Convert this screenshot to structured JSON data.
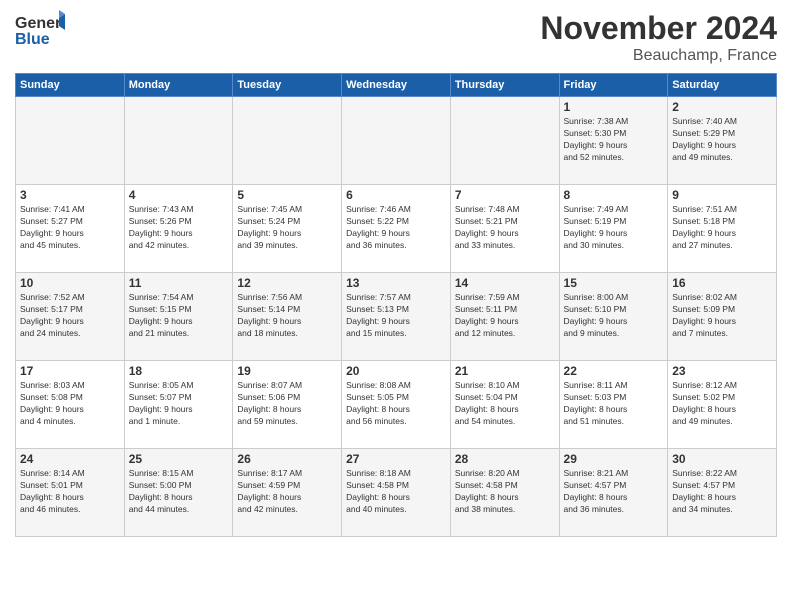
{
  "logo": {
    "general": "General",
    "blue": "Blue"
  },
  "title": {
    "month": "November 2024",
    "location": "Beauchamp, France"
  },
  "weekdays": [
    "Sunday",
    "Monday",
    "Tuesday",
    "Wednesday",
    "Thursday",
    "Friday",
    "Saturday"
  ],
  "weeks": [
    [
      {
        "day": "",
        "info": ""
      },
      {
        "day": "",
        "info": ""
      },
      {
        "day": "",
        "info": ""
      },
      {
        "day": "",
        "info": ""
      },
      {
        "day": "",
        "info": ""
      },
      {
        "day": "1",
        "info": "Sunrise: 7:38 AM\nSunset: 5:30 PM\nDaylight: 9 hours\nand 52 minutes."
      },
      {
        "day": "2",
        "info": "Sunrise: 7:40 AM\nSunset: 5:29 PM\nDaylight: 9 hours\nand 49 minutes."
      }
    ],
    [
      {
        "day": "3",
        "info": "Sunrise: 7:41 AM\nSunset: 5:27 PM\nDaylight: 9 hours\nand 45 minutes."
      },
      {
        "day": "4",
        "info": "Sunrise: 7:43 AM\nSunset: 5:26 PM\nDaylight: 9 hours\nand 42 minutes."
      },
      {
        "day": "5",
        "info": "Sunrise: 7:45 AM\nSunset: 5:24 PM\nDaylight: 9 hours\nand 39 minutes."
      },
      {
        "day": "6",
        "info": "Sunrise: 7:46 AM\nSunset: 5:22 PM\nDaylight: 9 hours\nand 36 minutes."
      },
      {
        "day": "7",
        "info": "Sunrise: 7:48 AM\nSunset: 5:21 PM\nDaylight: 9 hours\nand 33 minutes."
      },
      {
        "day": "8",
        "info": "Sunrise: 7:49 AM\nSunset: 5:19 PM\nDaylight: 9 hours\nand 30 minutes."
      },
      {
        "day": "9",
        "info": "Sunrise: 7:51 AM\nSunset: 5:18 PM\nDaylight: 9 hours\nand 27 minutes."
      }
    ],
    [
      {
        "day": "10",
        "info": "Sunrise: 7:52 AM\nSunset: 5:17 PM\nDaylight: 9 hours\nand 24 minutes."
      },
      {
        "day": "11",
        "info": "Sunrise: 7:54 AM\nSunset: 5:15 PM\nDaylight: 9 hours\nand 21 minutes."
      },
      {
        "day": "12",
        "info": "Sunrise: 7:56 AM\nSunset: 5:14 PM\nDaylight: 9 hours\nand 18 minutes."
      },
      {
        "day": "13",
        "info": "Sunrise: 7:57 AM\nSunset: 5:13 PM\nDaylight: 9 hours\nand 15 minutes."
      },
      {
        "day": "14",
        "info": "Sunrise: 7:59 AM\nSunset: 5:11 PM\nDaylight: 9 hours\nand 12 minutes."
      },
      {
        "day": "15",
        "info": "Sunrise: 8:00 AM\nSunset: 5:10 PM\nDaylight: 9 hours\nand 9 minutes."
      },
      {
        "day": "16",
        "info": "Sunrise: 8:02 AM\nSunset: 5:09 PM\nDaylight: 9 hours\nand 7 minutes."
      }
    ],
    [
      {
        "day": "17",
        "info": "Sunrise: 8:03 AM\nSunset: 5:08 PM\nDaylight: 9 hours\nand 4 minutes."
      },
      {
        "day": "18",
        "info": "Sunrise: 8:05 AM\nSunset: 5:07 PM\nDaylight: 9 hours\nand 1 minute."
      },
      {
        "day": "19",
        "info": "Sunrise: 8:07 AM\nSunset: 5:06 PM\nDaylight: 8 hours\nand 59 minutes."
      },
      {
        "day": "20",
        "info": "Sunrise: 8:08 AM\nSunset: 5:05 PM\nDaylight: 8 hours\nand 56 minutes."
      },
      {
        "day": "21",
        "info": "Sunrise: 8:10 AM\nSunset: 5:04 PM\nDaylight: 8 hours\nand 54 minutes."
      },
      {
        "day": "22",
        "info": "Sunrise: 8:11 AM\nSunset: 5:03 PM\nDaylight: 8 hours\nand 51 minutes."
      },
      {
        "day": "23",
        "info": "Sunrise: 8:12 AM\nSunset: 5:02 PM\nDaylight: 8 hours\nand 49 minutes."
      }
    ],
    [
      {
        "day": "24",
        "info": "Sunrise: 8:14 AM\nSunset: 5:01 PM\nDaylight: 8 hours\nand 46 minutes."
      },
      {
        "day": "25",
        "info": "Sunrise: 8:15 AM\nSunset: 5:00 PM\nDaylight: 8 hours\nand 44 minutes."
      },
      {
        "day": "26",
        "info": "Sunrise: 8:17 AM\nSunset: 4:59 PM\nDaylight: 8 hours\nand 42 minutes."
      },
      {
        "day": "27",
        "info": "Sunrise: 8:18 AM\nSunset: 4:58 PM\nDaylight: 8 hours\nand 40 minutes."
      },
      {
        "day": "28",
        "info": "Sunrise: 8:20 AM\nSunset: 4:58 PM\nDaylight: 8 hours\nand 38 minutes."
      },
      {
        "day": "29",
        "info": "Sunrise: 8:21 AM\nSunset: 4:57 PM\nDaylight: 8 hours\nand 36 minutes."
      },
      {
        "day": "30",
        "info": "Sunrise: 8:22 AM\nSunset: 4:57 PM\nDaylight: 8 hours\nand 34 minutes."
      }
    ]
  ]
}
